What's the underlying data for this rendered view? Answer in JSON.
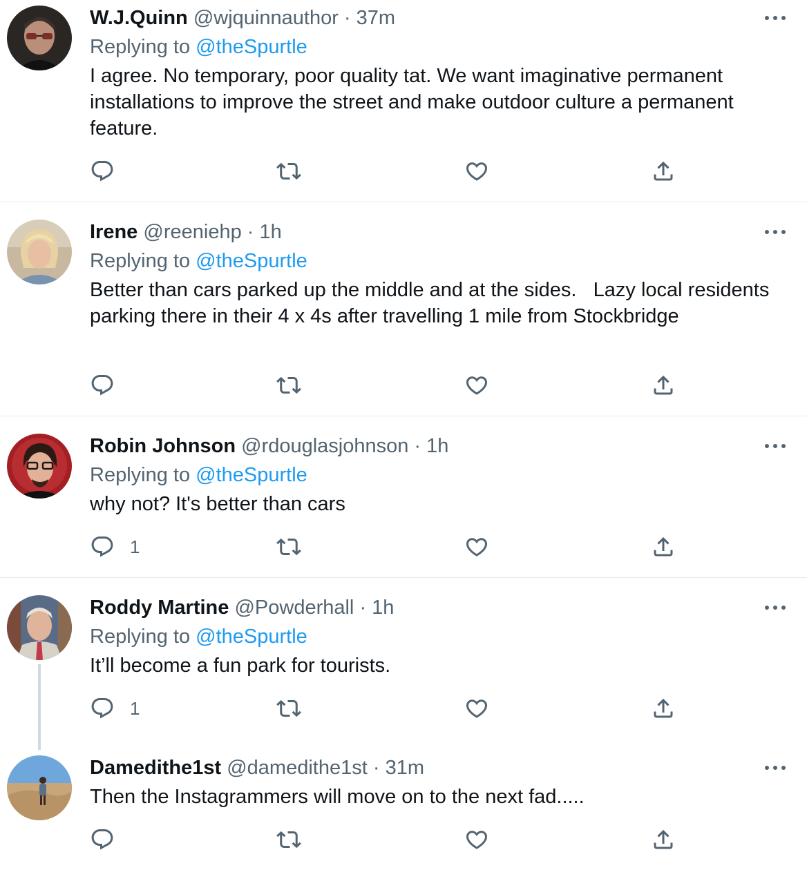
{
  "colors": {
    "accent": "#1d9bf0",
    "secondary": "#536471",
    "text": "#0f1419",
    "divider": "#e1e8ed"
  },
  "icons": {
    "reply": "reply-icon",
    "retweet": "retweet-icon",
    "like": "heart-icon",
    "share": "share-icon",
    "more": "more-icon"
  },
  "tweets": [
    {
      "name": "W.J.Quinn",
      "handle": "@wjquinnauthor",
      "dot": " · ",
      "time": "37m",
      "replying_prefix": "Replying to ",
      "replying_to": "@theSpurtle",
      "text": "I agree. No temporary, poor quality tat. We want imaginative permanent installations to improve the street and make outdoor culture a permanent feature.",
      "reply_count": ""
    },
    {
      "name": "Irene",
      "handle": "@reeniehp",
      "dot": " · ",
      "time": "1h",
      "replying_prefix": "Replying to ",
      "replying_to": "@theSpurtle",
      "text": "Better than cars parked up the middle and at the sides.   Lazy local residents parking there in their 4 x 4s after travelling 1 mile from Stockbridge",
      "reply_count": ""
    },
    {
      "name": "Robin Johnson",
      "handle": "@rdouglasjohnson",
      "dot": " · ",
      "time": "1h",
      "replying_prefix": "Replying to ",
      "replying_to": "@theSpurtle",
      "text": "why not? It's better than cars",
      "reply_count": "1"
    },
    {
      "name": "Roddy Martine",
      "handle": "@Powderhall",
      "dot": " · ",
      "time": "1h",
      "replying_prefix": "Replying to ",
      "replying_to": "@theSpurtle",
      "text": "It’ll become a fun park for tourists.",
      "reply_count": "1"
    },
    {
      "name": "Damedithe1st",
      "handle": "@damedithe1st",
      "dot": " · ",
      "time": "31m",
      "text": "Then the Instagrammers will move on to the next fad.....",
      "reply_count": ""
    }
  ]
}
